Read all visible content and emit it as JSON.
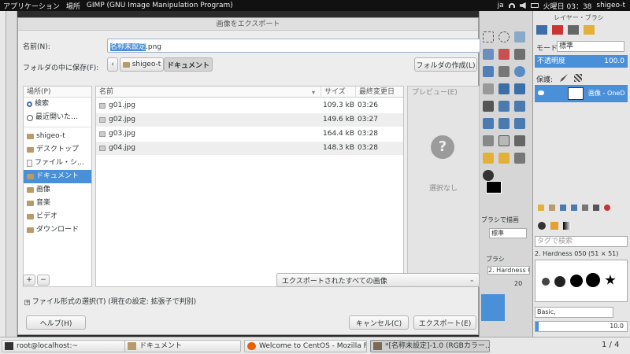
{
  "topbar": {
    "applications": "アプリケーション",
    "places": "場所",
    "app_title": "GIMP (GNU Image Manipulation Program)",
    "lang": "ja",
    "clock": "火曜日 03：38",
    "user": "shigeo-t"
  },
  "dialog": {
    "title": "画像をエクスポート",
    "name_label": "名前(N):",
    "name_selected": "名称未設定",
    "name_ext": ".png",
    "save_in_label": "フォルダの中に保存(F):",
    "path_back": "‹",
    "path": [
      "shigeo-t",
      "ドキュメント"
    ],
    "create_folder": "フォルダの作成(L)",
    "places_header": "場所(P)",
    "places": [
      {
        "label": "検索",
        "icon": "search-icon"
      },
      {
        "label": "最近開いた…",
        "icon": "clock-icon"
      },
      {
        "label": "shigeo-t",
        "icon": "home-folder-icon"
      },
      {
        "label": "デスクトップ",
        "icon": "folder-icon"
      },
      {
        "label": "ファイル・シ…",
        "icon": "drive-icon"
      },
      {
        "label": "ドキュメント",
        "icon": "folder-icon"
      },
      {
        "label": "画像",
        "icon": "folder-icon"
      },
      {
        "label": "音楽",
        "icon": "folder-icon"
      },
      {
        "label": "ビデオ",
        "icon": "folder-icon"
      },
      {
        "label": "ダウンロード",
        "icon": "folder-icon"
      }
    ],
    "add_label": "+",
    "remove_label": "−",
    "columns": {
      "name": "名前",
      "size": "サイズ",
      "modified": "最終変更日"
    },
    "files": [
      {
        "name": "g01.jpg",
        "size": "109.3 kB",
        "modified": "03:26"
      },
      {
        "name": "g02.jpg",
        "size": "149.6 kB",
        "modified": "03:27"
      },
      {
        "name": "g03.jpg",
        "size": "164.4 kB",
        "modified": "03:28"
      },
      {
        "name": "g04.jpg",
        "size": "148.3 kB",
        "modified": "03:28"
      }
    ],
    "preview_label": "プレビュー(E)",
    "preview_none": "選択なし",
    "filter": "エクスポートされたすべての画像",
    "file_type": "ファイル形式の選択(T) (現在の設定: 拡張子で判別)",
    "help": "ヘルプ(H)",
    "cancel": "キャンセル(C)",
    "export": "エクスポート(E)"
  },
  "layers": {
    "title": "レイヤー・ブラシ",
    "mode_label": "モード:",
    "mode_value": "標準",
    "opacity_label": "不透明度",
    "opacity_value": "100.0",
    "lock_label": "保護:",
    "layer_name": "画像 - OneD",
    "brush_filter": "タグで検索",
    "brush_name": "2. Hardness 050 (51 × 51)",
    "brush_preset": "Basic,",
    "spacing": "10.0"
  },
  "toolbox": {
    "brush_panel": "ブラシで描画",
    "mode": "標準",
    "brush": "ブラシ",
    "hardness": "2. Hardness 0",
    "num1": "20"
  },
  "taskbar": {
    "tasks": [
      {
        "label": "root@localhost:~",
        "icon": "terminal-icon"
      },
      {
        "label": "ドキュメント",
        "icon": "folder-icon"
      },
      {
        "label": "Welcome to CentOS - Mozilla Fi…",
        "icon": "firefox-icon"
      },
      {
        "label": "*[名称未設定]-1.0 (RGBカラー…",
        "icon": "gimp-icon"
      }
    ],
    "pager": "1 / 4"
  },
  "colors": {
    "accent": "#4a90d9",
    "topbar": "#111111"
  }
}
